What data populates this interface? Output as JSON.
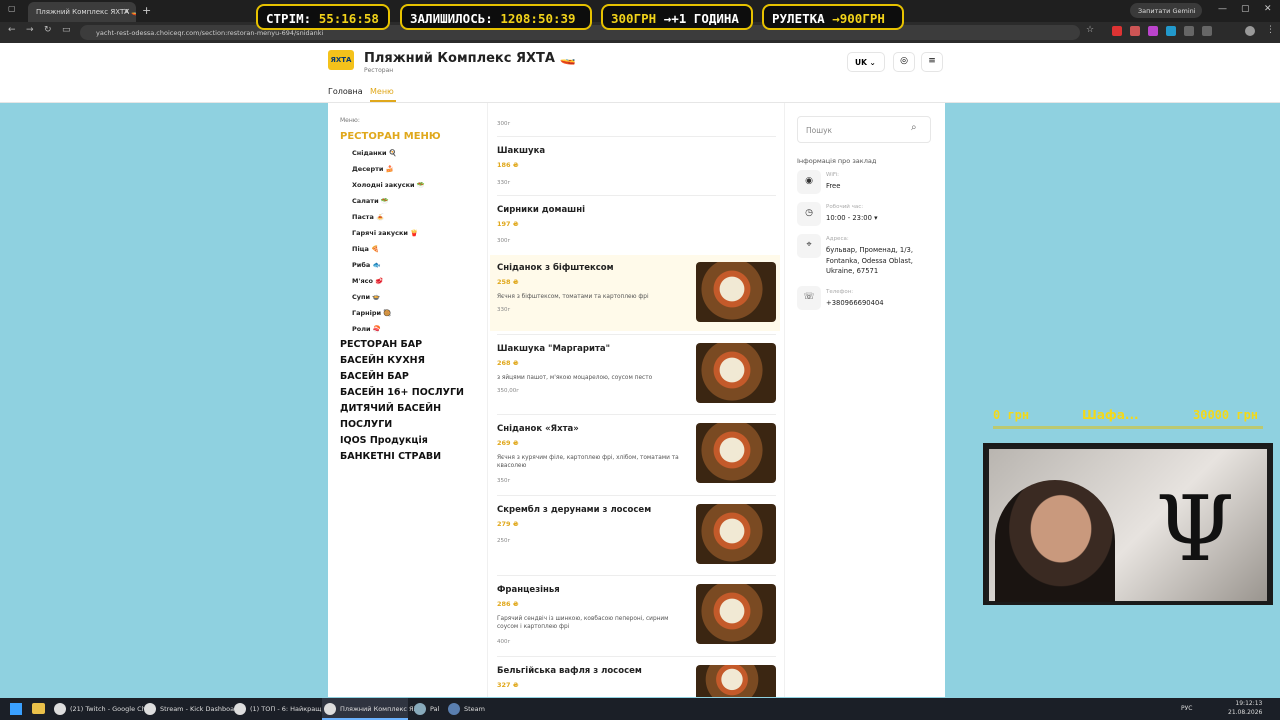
{
  "browser": {
    "tab_title": "Пляжний Комплекс ЯХТА 🚤",
    "url": "yacht-rest-odessa.choiceqr.com/section:restoran-menyu-694/snidanki",
    "gemini_label": "Запитати Gemini"
  },
  "site": {
    "logo_text": "ЯХТА",
    "title": "Пляжний Комплекс ЯХТА 🚤",
    "subtitle": "Ресторан",
    "lang": "UK",
    "nav": {
      "home": "Головна",
      "menu": "Меню"
    }
  },
  "sidebar": {
    "label": "Меню:",
    "active_category": "РЕСТОРАН МЕНЮ",
    "subcategories": [
      "Сніданки 🍳",
      "Десерти 🍰",
      "Холодні закуски 🥗",
      "Салати 🥗",
      "Паста 🍝",
      "Гарячі закуски 🍟",
      "Піца 🍕",
      "Риба 🐟",
      "М'ясо 🥩",
      "Супи 🍲",
      "Гарніри 🥘",
      "Роли 🍣"
    ],
    "categories": [
      "РЕСТОРАН БАР",
      "БАСЕЙН КУХНЯ",
      "БАСЕЙН БАР",
      "БАСЕЙН 16+ ПОСЛУГИ",
      "ДИТЯЧИЙ БАСЕЙН",
      "ПОСЛУГИ",
      "IQOS Продукція",
      "БАНКЕТНІ СТРАВИ"
    ]
  },
  "items": [
    {
      "name": "",
      "price": "",
      "desc": "",
      "weight": "300г"
    },
    {
      "name": "Шакшука",
      "price": "186 ₴",
      "desc": "",
      "weight": "330г"
    },
    {
      "name": "Сирники домашні",
      "price": "197 ₴",
      "desc": "",
      "weight": "300г"
    },
    {
      "name": "Сніданок з біфштексом",
      "price": "258 ₴",
      "desc": "Яєчня з біфштексом, томатами та картоплею фрі",
      "weight": "330г"
    },
    {
      "name": "Шакшука \"Маргарита\"",
      "price": "268 ₴",
      "desc": "з яйцями пашот, м'якою моцарелою, соусом песто",
      "weight": "350,00г"
    },
    {
      "name": "Сніданок «Яхта»",
      "price": "269 ₴",
      "desc": "Яєчня з курячим філе, картоплею фрі, хлібом, томатами та квасолею",
      "weight": "350г"
    },
    {
      "name": "Скрембл з дерунами з лососем",
      "price": "279 ₴",
      "desc": "",
      "weight": "250г"
    },
    {
      "name": "Францезінья",
      "price": "286 ₴",
      "desc": "Гарячий сендвіч із шинкою, ковбасою пепероні, сирним соусом і картоплею фрі",
      "weight": "400г"
    },
    {
      "name": "Бельгійська вафля з лососем",
      "price": "327 ₴",
      "desc": "",
      "weight": ""
    }
  ],
  "right": {
    "search_placeholder": "Пошук",
    "info_title": "Інформація про заклад",
    "info": [
      {
        "label": "WiFi:",
        "value": "Free",
        "icon": "wifi-icon"
      },
      {
        "label": "Робочий час:",
        "value": "10:00 - 23:00 ▾",
        "icon": "clock-icon"
      },
      {
        "label": "Адреса:",
        "value": "бульвар, Променад, 1/3, Fontanka, Odessa Oblast, Ukraine, 67571",
        "icon": "map-pin-icon"
      },
      {
        "label": "Телефон:",
        "value": "+380966690404",
        "icon": "phone-icon"
      }
    ]
  },
  "overlay": {
    "stream_label": "СТРІМ:",
    "stream_time": "55:16:58",
    "left_label": "ЗАЛИШИЛОСЬ:",
    "left_time": "1208:50:39",
    "rate_a": "300ГРН",
    "rate_b": "→+1 ГОДИНА",
    "roulette_label": "РУЛЕТКА",
    "roulette_val": "→900ГРН",
    "goal_left": "0 грн",
    "goal_mid": "Шафа...",
    "goal_right": "30000 грн"
  },
  "taskbar": {
    "apps": [
      "(21) Twitch - Google Chr",
      "Stream - Kick Dashboard",
      "(1) ТОП - 6: Найкращі б",
      "Пляжний Комплекс ЯХ",
      "Pal",
      "Steam"
    ],
    "lang": "РУС",
    "time": "19:12:13",
    "date": "21.08.2026"
  }
}
